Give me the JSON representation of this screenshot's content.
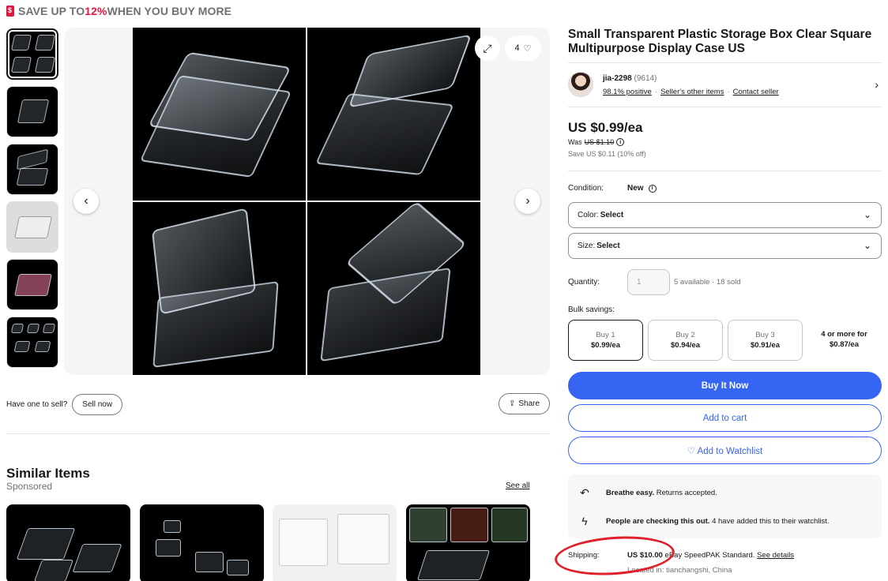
{
  "promo": {
    "prefix": "SAVE UP TO ",
    "highlight": "12%",
    "suffix": " WHEN YOU BUY MORE"
  },
  "gallery": {
    "watch_count": "4",
    "prev_icon": "chevron-left-icon",
    "next_icon": "chevron-right-icon",
    "thumbnail_count": 6
  },
  "sell": {
    "prompt": "Have one to sell?",
    "button": "Sell now",
    "share": "Share"
  },
  "similar": {
    "title": "Similar Items",
    "sponsored": "Sponsored",
    "see_all": "See all"
  },
  "listing": {
    "title": "Small Transparent Plastic Storage Box Clear Square Multipurpose Display Case US",
    "price": "US $0.99/ea",
    "was_label": "Was ",
    "was_price": "US $1.10",
    "save": "Save US $0.11 (10% off)",
    "condition_label": "Condition:",
    "condition_value": "New",
    "color_label": "Color:",
    "color_value": "Select",
    "size_label": "Size:",
    "size_value": "Select",
    "quantity_label": "Quantity:",
    "quantity_value": "1",
    "availability": "5 available · 18 sold",
    "bulk_label": "Bulk savings:",
    "bulk": [
      {
        "qty": "Buy 1",
        "price": "$0.99/ea"
      },
      {
        "qty": "Buy 2",
        "price": "$0.94/ea"
      },
      {
        "qty": "Buy 3",
        "price": "$0.91/ea"
      },
      {
        "qty": "4 or more for",
        "price": "$0.87/ea"
      }
    ],
    "buy_now": "Buy It Now",
    "add_to_cart": "Add to cart",
    "add_to_watchlist": "♡ Add to Watchlist"
  },
  "seller": {
    "name": "jia-2298",
    "feedback": "(9614)",
    "positive": "98.1% positive",
    "other_items": "Seller's other items",
    "contact": "Contact seller"
  },
  "info": {
    "returns_bold": "Breathe easy.",
    "returns_text": " Returns accepted.",
    "watch_bold": "People are checking this out.",
    "watch_text": " 4 have added this to their watchlist."
  },
  "shipping": {
    "label": "Shipping:",
    "price": "US $10.00",
    "method": " eBay SpeedPAK Standard. ",
    "details": "See details",
    "location": "Located in: tianchangshi, China"
  },
  "colors": {
    "accent": "#3665f3",
    "promo_red": "#e0173d",
    "annotation_red": "#e0202b"
  }
}
